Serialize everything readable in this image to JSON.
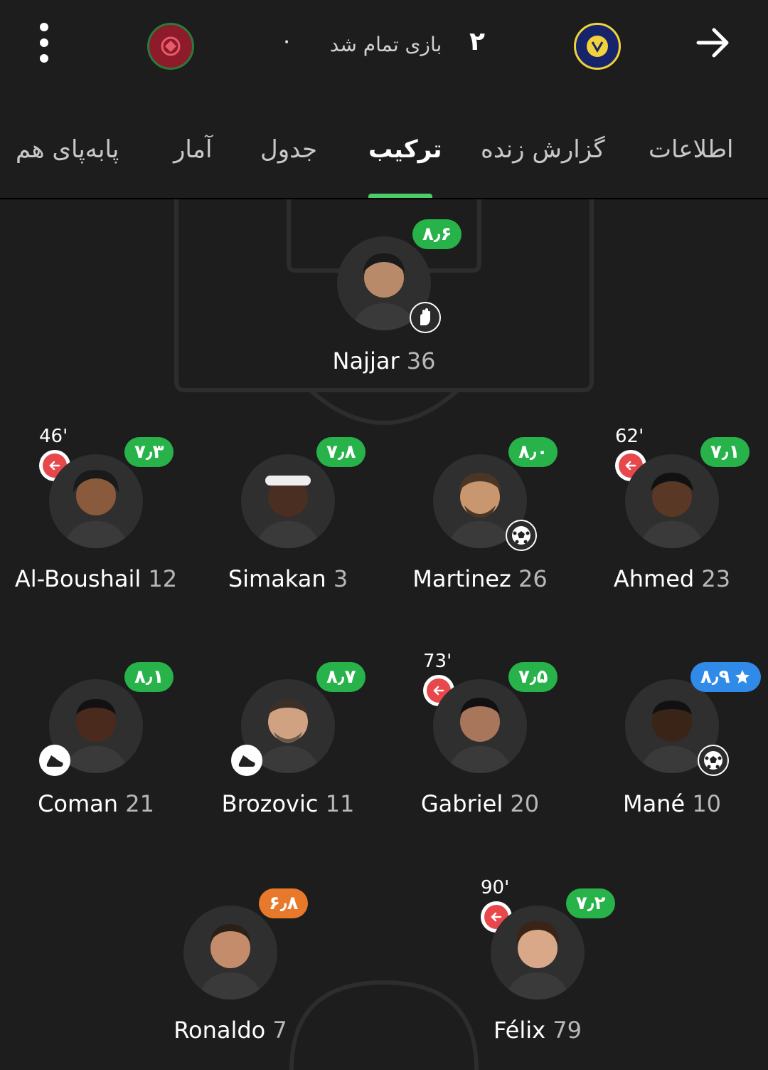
{
  "header": {
    "score_home": "۰",
    "score_away": "۲",
    "status": "بازی تمام شد",
    "home_logo": "al-kholood-logo",
    "away_logo": "al-nassr-logo"
  },
  "tabs": [
    {
      "label": "اطلاعات",
      "active": false
    },
    {
      "label": "گزارش زنده",
      "active": false
    },
    {
      "label": "ترکیب",
      "active": true
    },
    {
      "label": "جدول",
      "active": false
    },
    {
      "label": "آمار",
      "active": false
    },
    {
      "label": "پابه‌پای هم",
      "active": false
    }
  ],
  "colors": {
    "rating_green": "#27b24a",
    "rating_orange": "#e8782a",
    "rating_blue": "#2f8ae8",
    "sub_red": "#e8474b",
    "tab_indicator": "#4ccd6a"
  },
  "players": [
    {
      "name": "Najjar",
      "number": "36",
      "rating": "۸٫۶",
      "rating_color": "green",
      "event": "goalkeeper-glove-icon",
      "sub_time": ""
    },
    {
      "name": "Al-Boushail",
      "number": "12",
      "rating": "۷٫۳",
      "rating_color": "green",
      "event": "",
      "sub_time": "46'"
    },
    {
      "name": "Simakan",
      "number": "3",
      "rating": "۷٫۸",
      "rating_color": "green",
      "event": "",
      "sub_time": ""
    },
    {
      "name": "Martinez",
      "number": "26",
      "rating": "۸٫۰",
      "rating_color": "green",
      "event": "goal-ball-icon",
      "sub_time": ""
    },
    {
      "name": "Ahmed",
      "number": "23",
      "rating": "۷٫۱",
      "rating_color": "green",
      "event": "",
      "sub_time": "62'"
    },
    {
      "name": "Coman",
      "number": "21",
      "rating": "۸٫۱",
      "rating_color": "green",
      "event": "assist-boot-icon",
      "sub_time": ""
    },
    {
      "name": "Brozovic",
      "number": "11",
      "rating": "۸٫۷",
      "rating_color": "green",
      "event": "assist-boot-icon",
      "sub_time": ""
    },
    {
      "name": "Gabriel",
      "number": "20",
      "rating": "۷٫۵",
      "rating_color": "green",
      "event": "",
      "sub_time": "73'"
    },
    {
      "name": "Mané",
      "number": "10",
      "rating": "۸٫۹",
      "rating_color": "blue",
      "star": true,
      "event": "goal-ball-icon",
      "sub_time": ""
    },
    {
      "name": "Ronaldo",
      "number": "7",
      "rating": "۶٫۸",
      "rating_color": "orange",
      "event": "",
      "sub_time": ""
    },
    {
      "name": "Félix",
      "number": "79",
      "rating": "۷٫۲",
      "rating_color": "green",
      "event": "",
      "sub_time": "90'"
    }
  ]
}
